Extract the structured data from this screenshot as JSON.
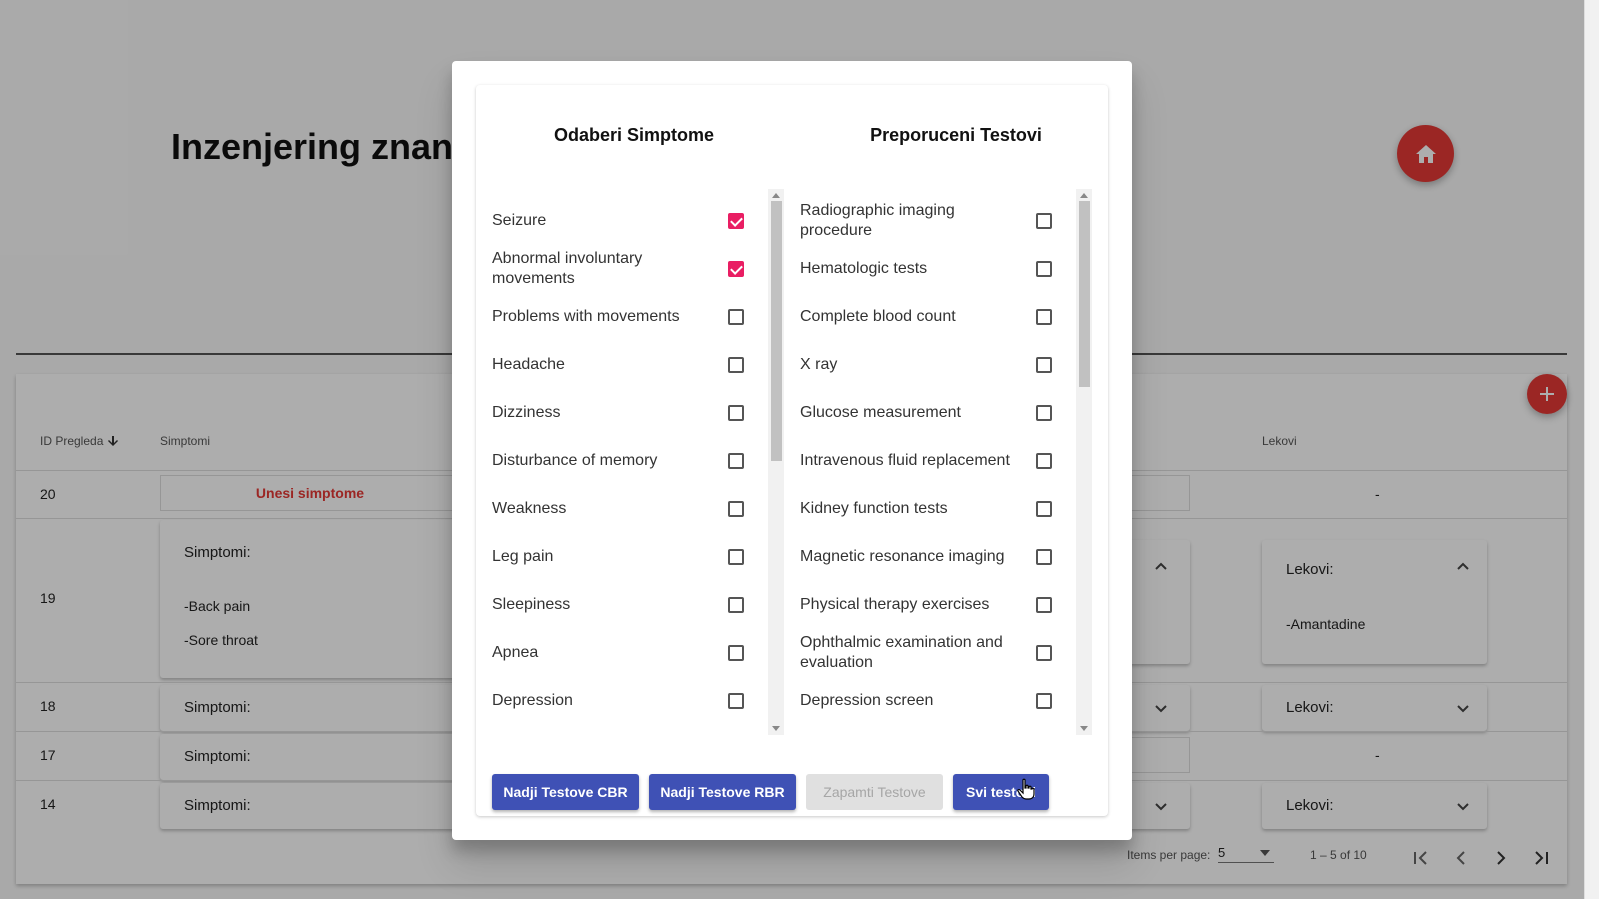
{
  "page": {
    "title": "Inzenjering znanja",
    "table": {
      "headers": {
        "id": "ID Pregleda",
        "simptomi": "Simptomi",
        "lekovi": "Lekovi"
      },
      "rows": [
        {
          "id": "20",
          "simptomi_button": "Unesi simptome",
          "lekovi": "-"
        },
        {
          "id": "19",
          "simptomi_title": "Simptomi:",
          "simptomi_items": [
            "-Back pain",
            "-Sore throat"
          ],
          "lekovi_title": "Lekovi:",
          "lekovi_items": [
            "-Amantadine"
          ]
        },
        {
          "id": "18",
          "simptomi_title": "Simptomi:",
          "lekovi_title": "Lekovi:"
        },
        {
          "id": "17",
          "simptomi_title": "Simptomi:",
          "lekovi": "-"
        },
        {
          "id": "14",
          "simptomi_title": "Simptomi:",
          "lekovi_title": "Lekovi:"
        }
      ]
    },
    "paginator": {
      "items_per_page_label": "Items per page:",
      "items_per_page": "5",
      "range": "1 – 5 of 10"
    }
  },
  "dialog": {
    "symptoms_title": "Odaberi Simptome",
    "tests_title": "Preporuceni Testovi",
    "symptoms": [
      {
        "label": "Seizure",
        "checked": true
      },
      {
        "label": "Abnormal involuntary movements",
        "checked": true
      },
      {
        "label": "Problems with movements",
        "checked": false
      },
      {
        "label": "Headache",
        "checked": false
      },
      {
        "label": "Dizziness",
        "checked": false
      },
      {
        "label": "Disturbance of memory",
        "checked": false
      },
      {
        "label": "Weakness",
        "checked": false
      },
      {
        "label": "Leg pain",
        "checked": false
      },
      {
        "label": "Sleepiness",
        "checked": false
      },
      {
        "label": "Apnea",
        "checked": false
      },
      {
        "label": "Depression",
        "checked": false
      }
    ],
    "tests": [
      {
        "label": "Radiographic imaging procedure",
        "checked": false
      },
      {
        "label": "Hematologic tests",
        "checked": false
      },
      {
        "label": "Complete blood count",
        "checked": false
      },
      {
        "label": "X ray",
        "checked": false
      },
      {
        "label": "Glucose measurement",
        "checked": false
      },
      {
        "label": "Intravenous fluid replacement",
        "checked": false
      },
      {
        "label": "Kidney function tests",
        "checked": false
      },
      {
        "label": "Magnetic resonance imaging",
        "checked": false
      },
      {
        "label": "Physical therapy exercises",
        "checked": false
      },
      {
        "label": "Ophthalmic examination and evaluation",
        "checked": false
      },
      {
        "label": "Depression screen",
        "checked": false
      }
    ],
    "buttons": {
      "cbr": "Nadji Testove CBR",
      "rbr": "Nadji Testove RBR",
      "save": "Zapamti Testove",
      "all": "Svi testovi"
    }
  },
  "colors": {
    "accent_red": "#e53935",
    "primary": "#3f51b5",
    "checkbox_pink": "#e91e63"
  }
}
